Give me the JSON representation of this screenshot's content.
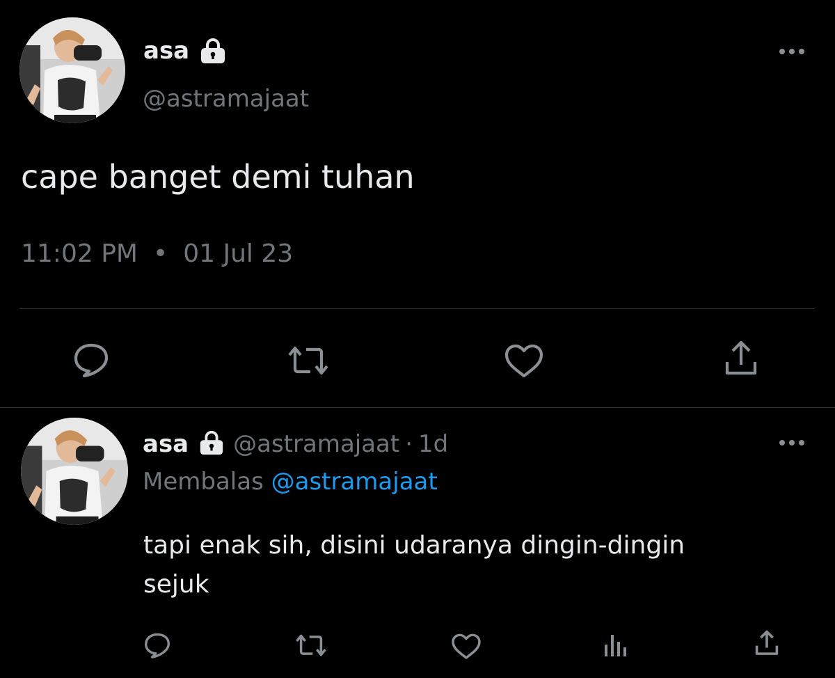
{
  "colors": {
    "background": "#000000",
    "primary_text": "#e7e9ea",
    "secondary_text": "#71767b",
    "mention": "#1d9bf0",
    "divider": "#2f3336"
  },
  "main_tweet": {
    "display_name": "asa",
    "handle": "@astramajaat",
    "text": "cape banget demi tuhan",
    "time": "11:02 PM",
    "separator": "•",
    "date": "01 Jul 23",
    "icons": [
      "lock-icon",
      "more-icon",
      "reply-icon",
      "retweet-icon",
      "like-icon",
      "share-icon"
    ]
  },
  "reply_tweet": {
    "display_name": "asa",
    "handle": "@astramajaat",
    "dot": "·",
    "relative_time": "1d",
    "replying_label": "Membalas",
    "replying_to": "@astramajaat",
    "text": "tapi enak sih, disini udaranya dingin-dingin\nsejuk",
    "icons": [
      "lock-icon",
      "more-icon",
      "reply-icon",
      "retweet-icon",
      "like-icon",
      "views-icon",
      "share-icon"
    ]
  }
}
